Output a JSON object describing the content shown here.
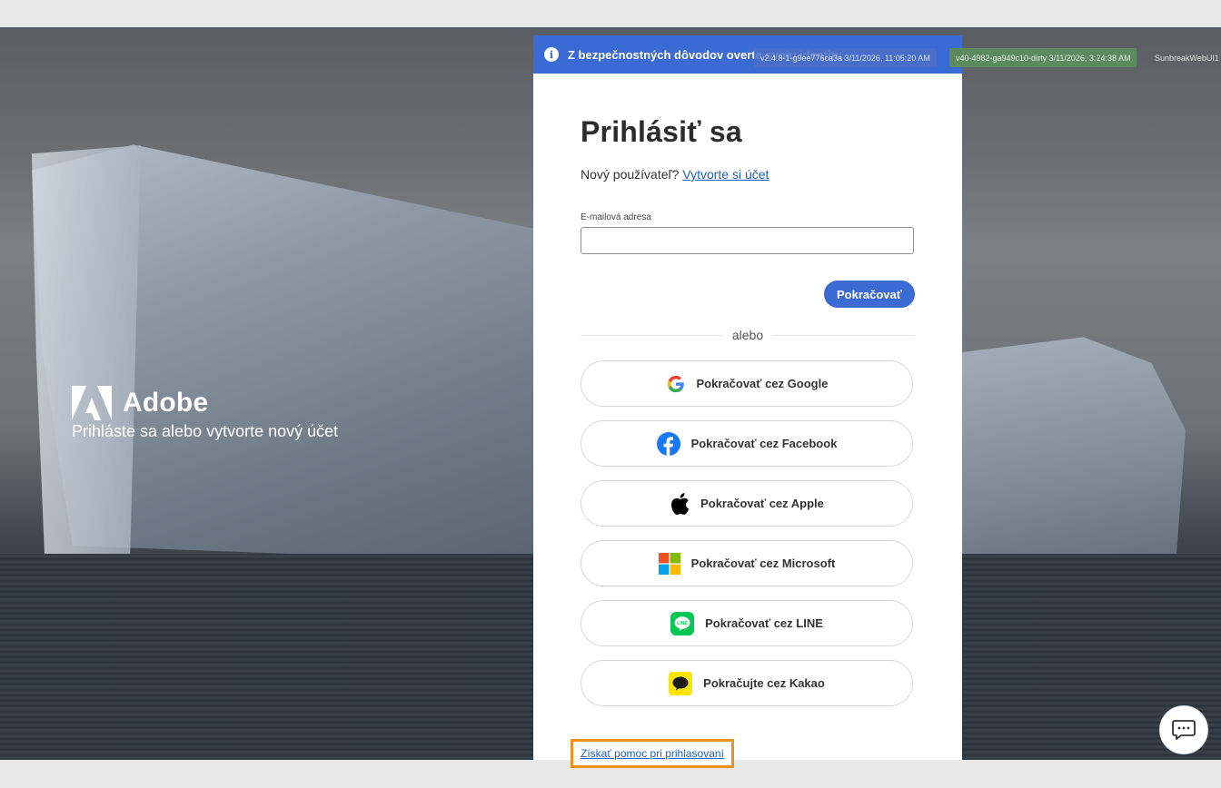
{
  "brand": {
    "name": "Adobe",
    "tagline": "Prihláste sa alebo vytvorte nový účet"
  },
  "banner": {
    "text": "Z bezpečnostných dôvodov overte svoju identitu.",
    "icon": "info-icon"
  },
  "signin": {
    "title": "Prihlásiť sa",
    "new_user_prompt": "Nový používateľ?",
    "create_account_link": "Vytvorte si účet",
    "email_label": "E-mailová adresa",
    "email_value": "",
    "continue_label": "Pokračovať",
    "divider_text": "alebo"
  },
  "social_buttons": [
    {
      "label": "Pokračovať cez Google",
      "icon": "google-icon"
    },
    {
      "label": "Pokračovať cez Facebook",
      "icon": "facebook-icon"
    },
    {
      "label": "Pokračovať cez Apple",
      "icon": "apple-icon"
    },
    {
      "label": "Pokračovať cez Microsoft",
      "icon": "microsoft-icon"
    },
    {
      "label": "Pokračovať cez LINE",
      "icon": "line-icon"
    },
    {
      "label": "Pokračujte cez Kakao",
      "icon": "kakao-icon"
    }
  ],
  "help_link": "Získať pomoc pri prihlasovaní",
  "version_badges": {
    "badge1": "v2.4.8-1-g9ee776ca3a 3/11/2026, 11:05:20 AM",
    "badge2": "v40-4982-ga949c10-dirty 3/11/2026, 3:24:38 AM",
    "badge3": "SunbreakWebUI1"
  },
  "colors": {
    "primary": "#3a6ad4",
    "link": "#1f5fbf",
    "highlight": "#f2901e"
  }
}
